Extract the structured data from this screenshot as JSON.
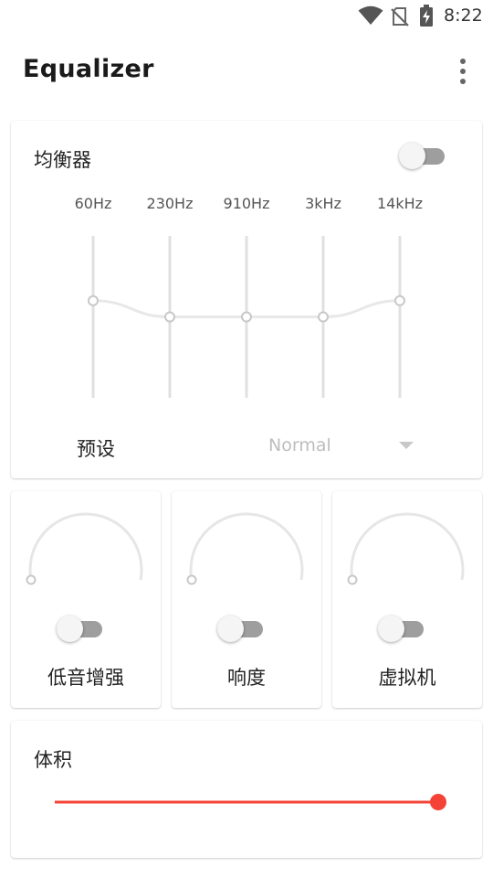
{
  "status_bar": {
    "time": "8:22",
    "icons": [
      "wifi-icon",
      "no-sim-icon",
      "battery-charging-icon"
    ]
  },
  "app_bar": {
    "title": "Equalizer",
    "menu_icon": "more-vert-icon"
  },
  "equalizer": {
    "title": "均衡器",
    "enabled": false,
    "bands": [
      {
        "label": "60Hz",
        "level": 0.6
      },
      {
        "label": "230Hz",
        "level": 0.5
      },
      {
        "label": "910Hz",
        "level": 0.5
      },
      {
        "label": "3kHz",
        "level": 0.5
      },
      {
        "label": "14kHz",
        "level": 0.6
      }
    ],
    "preset_label": "预设",
    "preset_value": "Normal"
  },
  "effects": [
    {
      "label": "低音增强",
      "enabled": false,
      "level": 0
    },
    {
      "label": "响度",
      "enabled": false,
      "level": 0
    },
    {
      "label": "虚拟机",
      "enabled": false,
      "level": 0
    }
  ],
  "volume": {
    "title": "体积",
    "level": 1.0
  },
  "colors": {
    "accent": "#f44336",
    "track_off": "#9e9e9e",
    "slider_line": "#e0e0e0",
    "disabled_text": "#bdbdbd"
  }
}
